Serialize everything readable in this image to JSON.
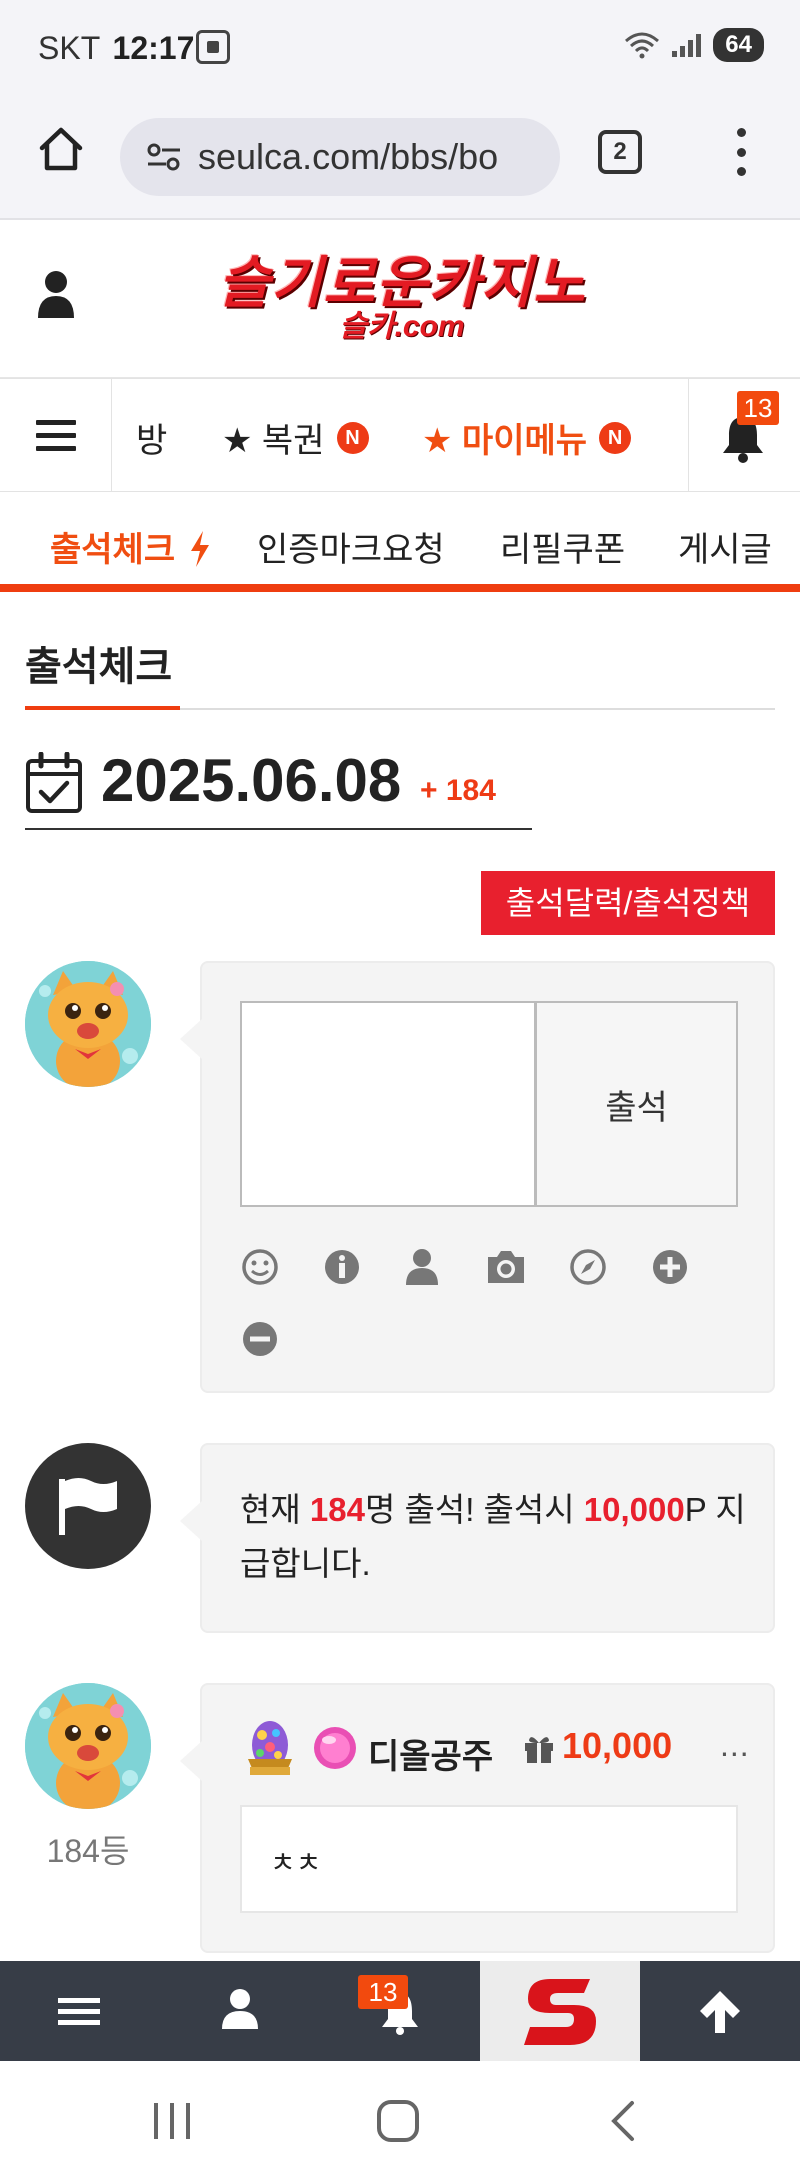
{
  "status_bar": {
    "carrier": "SKT",
    "time": "12:17",
    "battery": "64"
  },
  "browser": {
    "url": "seulca.com/bbs/bo",
    "tab_count": "2"
  },
  "site": {
    "logo_main": "슬기로운카지노",
    "logo_sub": "슬카.com"
  },
  "menu": {
    "partial_item": "방",
    "items": [
      {
        "label": "★ 복권",
        "badge": "N"
      },
      {
        "label": "★ 마이메뉴",
        "badge": "N"
      }
    ],
    "notification_count": "13"
  },
  "tabs": [
    {
      "label": "출석체크",
      "active": true
    },
    {
      "label": "인증마크요청"
    },
    {
      "label": "리필쿠폰"
    },
    {
      "label": "게시글"
    }
  ],
  "page": {
    "title": "출석체크",
    "date": "2025.06.08",
    "date_delta": "+ 184",
    "policy_button": "출석달력/출석정책"
  },
  "checkin_form": {
    "textarea_value": "",
    "submit_label": "출석",
    "tools": [
      "smile-icon",
      "info-icon",
      "user-icon",
      "camera-icon",
      "compass-icon",
      "plus-circle-icon",
      "minus-circle-icon"
    ]
  },
  "notice": {
    "prefix": "현재 ",
    "count": "184",
    "mid": "명 출석! 출석시 ",
    "points": "10,000",
    "suffix": "P 지급합니다."
  },
  "comments": [
    {
      "rank": "184등",
      "name": "디올공주",
      "points": "10,000",
      "more": "...",
      "body": "ㅊㅊ"
    }
  ],
  "bottom_nav": {
    "notification_count": "13"
  },
  "colors": {
    "accent": "#ef3d10",
    "brand_red": "#e8202e",
    "nav_dark": "#373d47"
  }
}
